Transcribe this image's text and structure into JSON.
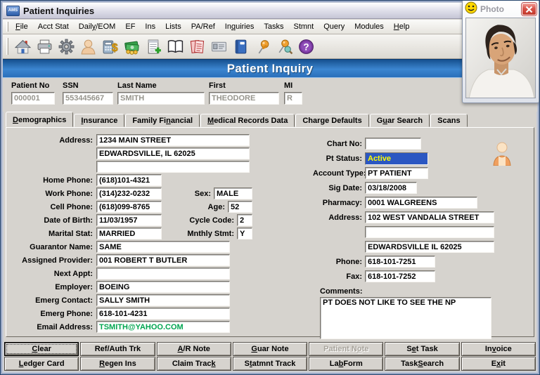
{
  "window": {
    "title": "Patient Inquiries",
    "app_icon_label": "AMS"
  },
  "menu": {
    "items": [
      {
        "label": "File",
        "accel": 0
      },
      {
        "label": "Acct Stat",
        "accel": null
      },
      {
        "label": "Daily/EOM",
        "accel": 4
      },
      {
        "label": "EF",
        "accel": null
      },
      {
        "label": "Ins",
        "accel": null
      },
      {
        "label": "Lists",
        "accel": null
      },
      {
        "label": "PA/Ref",
        "accel": null
      },
      {
        "label": "Inquiries",
        "accel": 2
      },
      {
        "label": "Tasks",
        "accel": null
      },
      {
        "label": "Stmnt",
        "accel": null
      },
      {
        "label": "Query",
        "accel": null
      },
      {
        "label": "Modules",
        "accel": null
      },
      {
        "label": "Help",
        "accel": 0
      }
    ]
  },
  "toolbar": {
    "icons": [
      "home",
      "print",
      "settings",
      "patient",
      "billing-calculator",
      "payments",
      "new-form",
      "codes-book",
      "notes",
      "id-card",
      "ledger-book",
      "task-pin",
      "task-search-pin",
      "help"
    ]
  },
  "header": {
    "title": "Patient Inquiry"
  },
  "patient_bar": {
    "fields": [
      {
        "label": "Patient No",
        "value": "000001"
      },
      {
        "label": "SSN",
        "value": "553445667"
      },
      {
        "label": "Last Name",
        "value": "SMITH"
      },
      {
        "label": "First",
        "value": "THEODORE"
      },
      {
        "label": "MI",
        "value": "R"
      }
    ]
  },
  "tabs": [
    {
      "label": "Demographics",
      "accel": 0,
      "active": true
    },
    {
      "label": "Insurance",
      "accel": 0,
      "active": false
    },
    {
      "label": "Family Financial",
      "accel": 9,
      "active": false
    },
    {
      "label": "Medical Records Data",
      "accel": 0,
      "active": false
    },
    {
      "label": "Charge Defaults",
      "accel": null,
      "active": false
    },
    {
      "label": "Guar Search",
      "accel": 1,
      "active": false
    },
    {
      "label": "Scans",
      "accel": null,
      "active": false
    }
  ],
  "demographics": {
    "left": {
      "address": {
        "label": "Address:",
        "line1": "1234 MAIN STREET",
        "line2": "EDWARDSVILLE, IL 62025",
        "line3": ""
      },
      "home_phone": {
        "label": "Home Phone:",
        "value": "(618)101-4321"
      },
      "work_phone": {
        "label": "Work Phone:",
        "value": "(314)232-0232"
      },
      "cell_phone": {
        "label": "Cell Phone:",
        "value": "(618)099-8765"
      },
      "dob": {
        "label": "Date of Birth:",
        "value": "11/03/1957"
      },
      "marital": {
        "label": "Marital Stat:",
        "value": "MARRIED"
      },
      "guarantor": {
        "label": "Guarantor Name:",
        "value": "SAME"
      },
      "provider": {
        "label": "Assigned Provider:",
        "value": "001 ROBERT T BUTLER"
      },
      "next_appt": {
        "label": "Next Appt:",
        "value": ""
      },
      "employer": {
        "label": "Employer:",
        "value": "BOEING"
      },
      "emerg_contact": {
        "label": "Emerg Contact:",
        "value": "SALLY SMITH"
      },
      "emerg_phone": {
        "label": "Emerg Phone:",
        "value": "618-101-4231"
      },
      "email": {
        "label": "Email Address:",
        "value": "TSMITH@YAHOO.COM"
      }
    },
    "mid": {
      "sex": {
        "label": "Sex:",
        "value": "MALE"
      },
      "age": {
        "label": "Age:",
        "value": "52"
      },
      "cycle_code": {
        "label": "Cycle Code:",
        "value": "2"
      },
      "monthly_stmt": {
        "label": "Mnthly Stmt:",
        "value": "Y"
      }
    },
    "right": {
      "chart_no": {
        "label": "Chart No:",
        "value": ""
      },
      "pt_status": {
        "label": "Pt Status:",
        "value": "Active"
      },
      "account_type": {
        "label": "Account Type:",
        "value": "PT PATIENT"
      },
      "sig_date": {
        "label": "Sig Date:",
        "value": "03/18/2008"
      },
      "pharmacy": {
        "label": "Pharmacy:",
        "value": "0001 WALGREENS"
      },
      "pharmacy_address": {
        "label": "Address:",
        "line1": "102 WEST VANDALIA STREET",
        "line2": "",
        "line3": "EDWARDSVILLE IL 62025"
      },
      "phone": {
        "label": "Phone:",
        "value": "618-101-7251"
      },
      "fax": {
        "label": "Fax:",
        "value": "618-101-7252"
      },
      "comments": {
        "label": "Comments:",
        "value": "PT DOES NOT LIKE TO SEE THE NP"
      }
    }
  },
  "photo_window": {
    "title": "Photo"
  },
  "action_buttons": {
    "row1": [
      {
        "label": "Clear",
        "accel": 0,
        "disabled": false
      },
      {
        "label": "Ref/Auth Trk",
        "accel": null,
        "disabled": false
      },
      {
        "label": "A/R Note",
        "accel": 0,
        "disabled": false
      },
      {
        "label": "Guar Note",
        "accel": 0,
        "disabled": false
      },
      {
        "label": "Patient Note",
        "accel": 9,
        "disabled": true
      },
      {
        "label": "Set Task",
        "accel": 1,
        "disabled": false
      },
      {
        "label": "Invoice",
        "accel": 2,
        "disabled": false
      }
    ],
    "row2": [
      {
        "label": "Ledger Card",
        "accel": 0,
        "disabled": false
      },
      {
        "label": "Regen Ins",
        "accel": 0,
        "disabled": false
      },
      {
        "label": "Claim Track",
        "accel": 10,
        "disabled": false
      },
      {
        "label": "Statmnt Track",
        "accel": 1,
        "disabled": false
      },
      {
        "label": "Lab Form",
        "accel": 2,
        "disabled": false
      },
      {
        "label": "Task Search",
        "accel": 5,
        "disabled": false
      },
      {
        "label": "Exit",
        "accel": 1,
        "disabled": false
      }
    ]
  },
  "colors": {
    "header_blue_top": "#16508f",
    "header_blue_mid": "#3c86d0",
    "status_bg": "#2b57c2",
    "status_text": "#ffff00",
    "email_green": "#00a550"
  }
}
